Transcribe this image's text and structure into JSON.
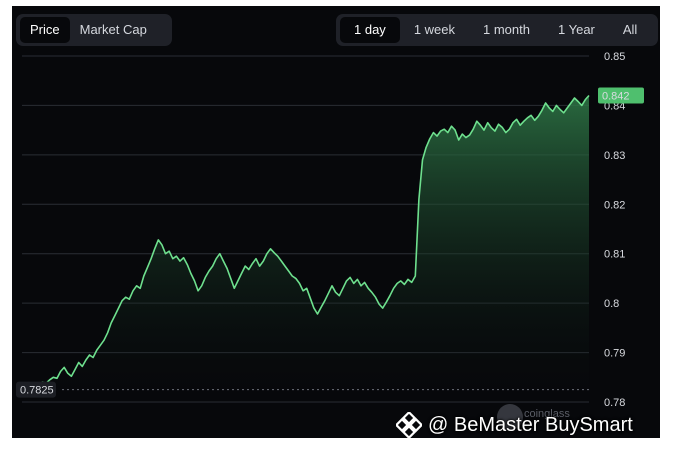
{
  "tabs_left": [
    {
      "label": "Price",
      "active": true
    },
    {
      "label": "Market Cap",
      "active": false
    }
  ],
  "tabs_right": [
    {
      "label": "1 day",
      "active": true
    },
    {
      "label": "1 week",
      "active": false
    },
    {
      "label": "1 month",
      "active": false
    },
    {
      "label": "1 Year",
      "active": false
    },
    {
      "label": "All",
      "active": false
    }
  ],
  "chart_data": {
    "type": "area",
    "y_ticks": [
      "0.85",
      "0.84",
      "0.83",
      "0.82",
      "0.81",
      "0.8",
      "0.79",
      "0.78"
    ],
    "ylim": [
      0.78,
      0.85
    ],
    "grid": true,
    "current_price_label": "0.842",
    "reference_price_label": "0.7825",
    "colors": {
      "line": "#6ee08e",
      "fill_top": "#2f7a48",
      "fill_bottom": "#07080b",
      "badge": "#4fbf6e"
    },
    "series": [
      {
        "values": [
          0.7828,
          0.7832,
          0.783,
          0.7835,
          0.784,
          0.7838,
          0.7845,
          0.785,
          0.7848,
          0.7862,
          0.787,
          0.7858,
          0.7852,
          0.7866,
          0.788,
          0.7872,
          0.7885,
          0.7895,
          0.789,
          0.7905,
          0.7915,
          0.7925,
          0.794,
          0.796,
          0.7975,
          0.799,
          0.8005,
          0.8012,
          0.8008,
          0.8025,
          0.8035,
          0.803,
          0.8055,
          0.8072,
          0.809,
          0.811,
          0.8128,
          0.8118,
          0.81,
          0.8105,
          0.809,
          0.8095,
          0.8085,
          0.8092,
          0.8078,
          0.806,
          0.8045,
          0.8025,
          0.8035,
          0.8052,
          0.8065,
          0.8075,
          0.809,
          0.81,
          0.8085,
          0.807,
          0.805,
          0.803,
          0.8045,
          0.806,
          0.8075,
          0.8068,
          0.808,
          0.809,
          0.8075,
          0.8085,
          0.81,
          0.811,
          0.8102,
          0.8095,
          0.8085,
          0.8075,
          0.8065,
          0.8055,
          0.805,
          0.804,
          0.8025,
          0.803,
          0.801,
          0.799,
          0.7978,
          0.7992,
          0.8005,
          0.802,
          0.8035,
          0.8022,
          0.8015,
          0.803,
          0.8045,
          0.8052,
          0.804,
          0.8048,
          0.8035,
          0.8042,
          0.803,
          0.8022,
          0.8012,
          0.7998,
          0.799,
          0.8002,
          0.8015,
          0.803,
          0.804,
          0.8045,
          0.8038,
          0.8048,
          0.8042,
          0.8055,
          0.821,
          0.829,
          0.8315,
          0.8332,
          0.8345,
          0.8338,
          0.8348,
          0.8352,
          0.8345,
          0.8358,
          0.835,
          0.833,
          0.8342,
          0.8335,
          0.834,
          0.8352,
          0.8368,
          0.836,
          0.835,
          0.8365,
          0.8355,
          0.8348,
          0.8362,
          0.8356,
          0.8345,
          0.8352,
          0.8365,
          0.8372,
          0.836,
          0.8368,
          0.8375,
          0.838,
          0.837,
          0.8378,
          0.839,
          0.8405,
          0.8395,
          0.8388,
          0.84,
          0.8392,
          0.8385,
          0.8395,
          0.8405,
          0.8415,
          0.8408,
          0.84,
          0.8412,
          0.842
        ]
      }
    ]
  },
  "watermark": "coinglass",
  "credit_text": "@ BeMaster BuySmart"
}
